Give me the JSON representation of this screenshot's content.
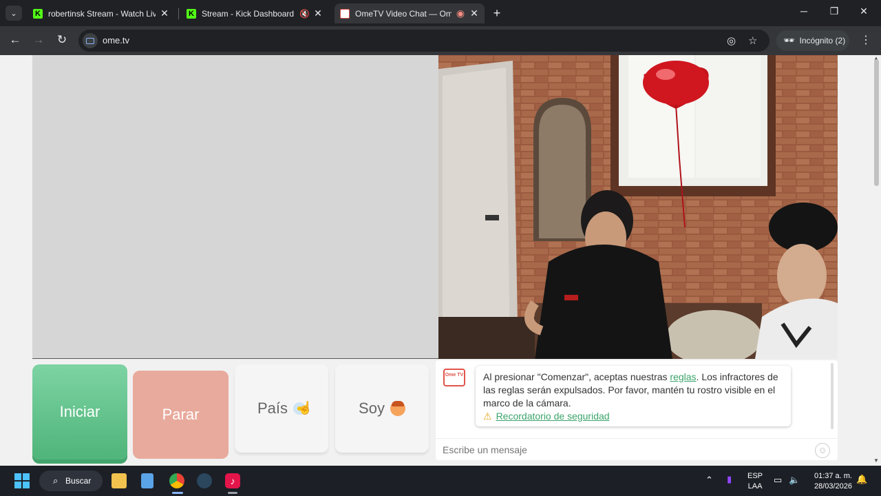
{
  "browser": {
    "tabs": [
      {
        "title": "robertinsk Stream - Watch Live",
        "favicon": "kick-icon"
      },
      {
        "title": "Stream - Kick Dashboard",
        "favicon": "kick-icon"
      },
      {
        "title": "OmeTV Video Chat — Ome",
        "favicon": "ometv-icon"
      }
    ],
    "url": "ome.tv",
    "incognito_label": "Incógnito (2)"
  },
  "controls": {
    "start_label": "Iniciar",
    "stop_label": "Parar",
    "country_label": "País",
    "gender_label": "Soy"
  },
  "chat": {
    "logo_text": "Ome TV",
    "rules_before": "Al presionar \"Comenzar\", aceptas nuestras ",
    "rules_link": "reglas",
    "rules_after": ". Los infractores de las reglas serán expulsados. Por favor, mantén tu rostro visible en el marco de la cámara.",
    "safety_link": "Recordatorio de seguridad",
    "input_placeholder": "Escribe un mensaje"
  },
  "taskbar": {
    "search_label": "Buscar",
    "lang_top": "ESP",
    "lang_bottom": "LAA",
    "time": "01:37 a. m.",
    "date": "28/03/2026"
  },
  "colors": {
    "start_green": "#5cc08a",
    "stop_salmon": "#e8aa9c",
    "link_green": "#3aa36a",
    "kick_green": "#53fc18"
  }
}
